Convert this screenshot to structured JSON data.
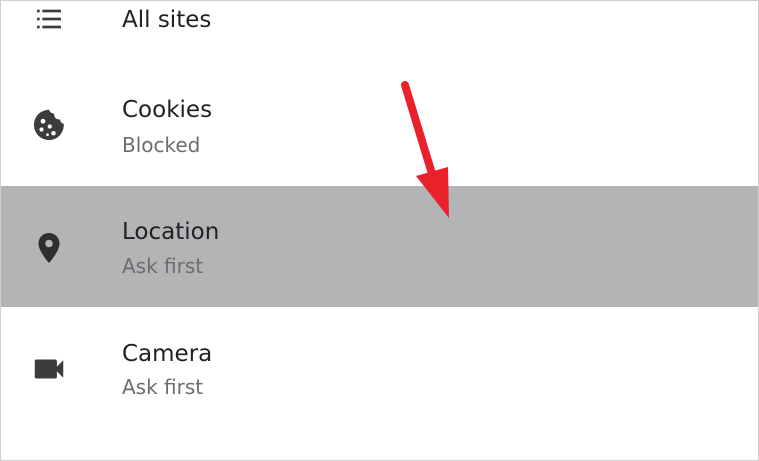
{
  "list": {
    "all_sites": {
      "label": "All sites",
      "icon": "list-icon"
    },
    "items": [
      {
        "title": "Cookies",
        "subtitle": "Blocked",
        "icon": "cookie-icon"
      },
      {
        "title": "Location",
        "subtitle": "Ask first",
        "icon": "location-pin-icon",
        "highlighted": true
      },
      {
        "title": "Camera",
        "subtitle": "Ask first",
        "icon": "video-camera-icon"
      }
    ]
  },
  "colors": {
    "text_primary": "#202124",
    "text_secondary": "#6b6d70",
    "icon": "#3c3c3c",
    "highlight": "#b3b4b5",
    "annotation_arrow": "#e8212b"
  }
}
